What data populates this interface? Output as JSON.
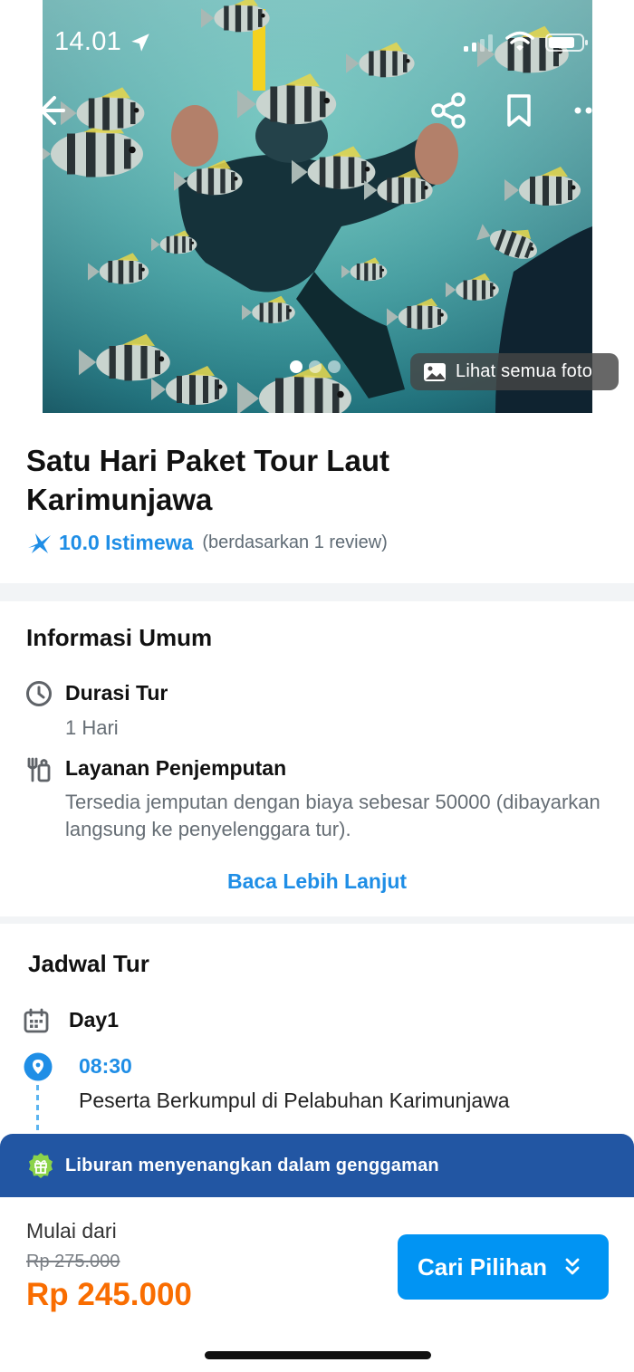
{
  "status_bar": {
    "time": "14.01"
  },
  "hero": {
    "see_all_photos": "Lihat semua foto",
    "photo_count_dots": 3,
    "active_photo_index": 1
  },
  "tour": {
    "title": "Satu Hari Paket Tour Laut Karimunjawa",
    "rating_score": "10.0 Istimewa",
    "rating_note": "(berdasarkan 1 review)"
  },
  "general_info": {
    "heading": "Informasi Umum",
    "duration_label": "Durasi Tur",
    "duration_value": "1 Hari",
    "pickup_label": "Layanan Penjemputan",
    "pickup_value": "Tersedia jemputan dengan biaya sebesar 50000 (dibayarkan langsung ke penyelenggara tur).",
    "read_more": "Baca Lebih Lanjut"
  },
  "schedule": {
    "heading": "Jadwal Tur",
    "day_label": "Day1",
    "items": [
      {
        "time": "08:30",
        "activity": "Peserta Berkumpul di Pelabuhan Karimunjawa"
      }
    ]
  },
  "promo_banner": {
    "text": "Liburan menyenangkan dalam genggaman"
  },
  "footer": {
    "start_from": "Mulai dari",
    "old_price": "Rp 275.000",
    "new_price": "Rp 245.000",
    "cta_label": "Cari Pilihan"
  },
  "colors": {
    "accent_blue": "#0194f3",
    "link_blue": "#1f8ee6",
    "price_orange": "#f96d01",
    "banner_blue": "#2256a3"
  }
}
